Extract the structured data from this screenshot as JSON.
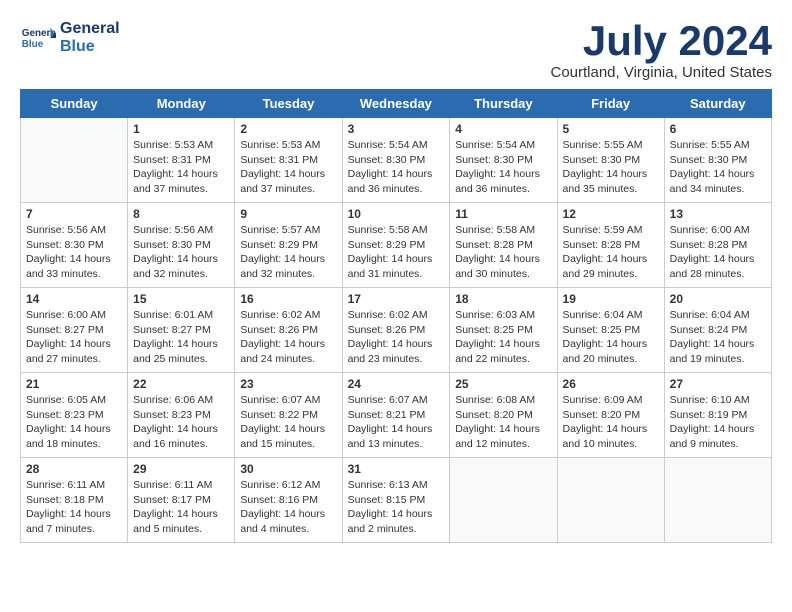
{
  "logo": {
    "text_general": "General",
    "text_blue": "Blue"
  },
  "title": "July 2024",
  "location": "Courtland, Virginia, United States",
  "days_header": [
    "Sunday",
    "Monday",
    "Tuesday",
    "Wednesday",
    "Thursday",
    "Friday",
    "Saturday"
  ],
  "weeks": [
    [
      {
        "day": "",
        "info": ""
      },
      {
        "day": "1",
        "info": "Sunrise: 5:53 AM\nSunset: 8:31 PM\nDaylight: 14 hours\nand 37 minutes."
      },
      {
        "day": "2",
        "info": "Sunrise: 5:53 AM\nSunset: 8:31 PM\nDaylight: 14 hours\nand 37 minutes."
      },
      {
        "day": "3",
        "info": "Sunrise: 5:54 AM\nSunset: 8:30 PM\nDaylight: 14 hours\nand 36 minutes."
      },
      {
        "day": "4",
        "info": "Sunrise: 5:54 AM\nSunset: 8:30 PM\nDaylight: 14 hours\nand 36 minutes."
      },
      {
        "day": "5",
        "info": "Sunrise: 5:55 AM\nSunset: 8:30 PM\nDaylight: 14 hours\nand 35 minutes."
      },
      {
        "day": "6",
        "info": "Sunrise: 5:55 AM\nSunset: 8:30 PM\nDaylight: 14 hours\nand 34 minutes."
      }
    ],
    [
      {
        "day": "7",
        "info": "Sunrise: 5:56 AM\nSunset: 8:30 PM\nDaylight: 14 hours\nand 33 minutes."
      },
      {
        "day": "8",
        "info": "Sunrise: 5:56 AM\nSunset: 8:30 PM\nDaylight: 14 hours\nand 32 minutes."
      },
      {
        "day": "9",
        "info": "Sunrise: 5:57 AM\nSunset: 8:29 PM\nDaylight: 14 hours\nand 32 minutes."
      },
      {
        "day": "10",
        "info": "Sunrise: 5:58 AM\nSunset: 8:29 PM\nDaylight: 14 hours\nand 31 minutes."
      },
      {
        "day": "11",
        "info": "Sunrise: 5:58 AM\nSunset: 8:28 PM\nDaylight: 14 hours\nand 30 minutes."
      },
      {
        "day": "12",
        "info": "Sunrise: 5:59 AM\nSunset: 8:28 PM\nDaylight: 14 hours\nand 29 minutes."
      },
      {
        "day": "13",
        "info": "Sunrise: 6:00 AM\nSunset: 8:28 PM\nDaylight: 14 hours\nand 28 minutes."
      }
    ],
    [
      {
        "day": "14",
        "info": "Sunrise: 6:00 AM\nSunset: 8:27 PM\nDaylight: 14 hours\nand 27 minutes."
      },
      {
        "day": "15",
        "info": "Sunrise: 6:01 AM\nSunset: 8:27 PM\nDaylight: 14 hours\nand 25 minutes."
      },
      {
        "day": "16",
        "info": "Sunrise: 6:02 AM\nSunset: 8:26 PM\nDaylight: 14 hours\nand 24 minutes."
      },
      {
        "day": "17",
        "info": "Sunrise: 6:02 AM\nSunset: 8:26 PM\nDaylight: 14 hours\nand 23 minutes."
      },
      {
        "day": "18",
        "info": "Sunrise: 6:03 AM\nSunset: 8:25 PM\nDaylight: 14 hours\nand 22 minutes."
      },
      {
        "day": "19",
        "info": "Sunrise: 6:04 AM\nSunset: 8:25 PM\nDaylight: 14 hours\nand 20 minutes."
      },
      {
        "day": "20",
        "info": "Sunrise: 6:04 AM\nSunset: 8:24 PM\nDaylight: 14 hours\nand 19 minutes."
      }
    ],
    [
      {
        "day": "21",
        "info": "Sunrise: 6:05 AM\nSunset: 8:23 PM\nDaylight: 14 hours\nand 18 minutes."
      },
      {
        "day": "22",
        "info": "Sunrise: 6:06 AM\nSunset: 8:23 PM\nDaylight: 14 hours\nand 16 minutes."
      },
      {
        "day": "23",
        "info": "Sunrise: 6:07 AM\nSunset: 8:22 PM\nDaylight: 14 hours\nand 15 minutes."
      },
      {
        "day": "24",
        "info": "Sunrise: 6:07 AM\nSunset: 8:21 PM\nDaylight: 14 hours\nand 13 minutes."
      },
      {
        "day": "25",
        "info": "Sunrise: 6:08 AM\nSunset: 8:20 PM\nDaylight: 14 hours\nand 12 minutes."
      },
      {
        "day": "26",
        "info": "Sunrise: 6:09 AM\nSunset: 8:20 PM\nDaylight: 14 hours\nand 10 minutes."
      },
      {
        "day": "27",
        "info": "Sunrise: 6:10 AM\nSunset: 8:19 PM\nDaylight: 14 hours\nand 9 minutes."
      }
    ],
    [
      {
        "day": "28",
        "info": "Sunrise: 6:11 AM\nSunset: 8:18 PM\nDaylight: 14 hours\nand 7 minutes."
      },
      {
        "day": "29",
        "info": "Sunrise: 6:11 AM\nSunset: 8:17 PM\nDaylight: 14 hours\nand 5 minutes."
      },
      {
        "day": "30",
        "info": "Sunrise: 6:12 AM\nSunset: 8:16 PM\nDaylight: 14 hours\nand 4 minutes."
      },
      {
        "day": "31",
        "info": "Sunrise: 6:13 AM\nSunset: 8:15 PM\nDaylight: 14 hours\nand 2 minutes."
      },
      {
        "day": "",
        "info": ""
      },
      {
        "day": "",
        "info": ""
      },
      {
        "day": "",
        "info": ""
      }
    ]
  ]
}
